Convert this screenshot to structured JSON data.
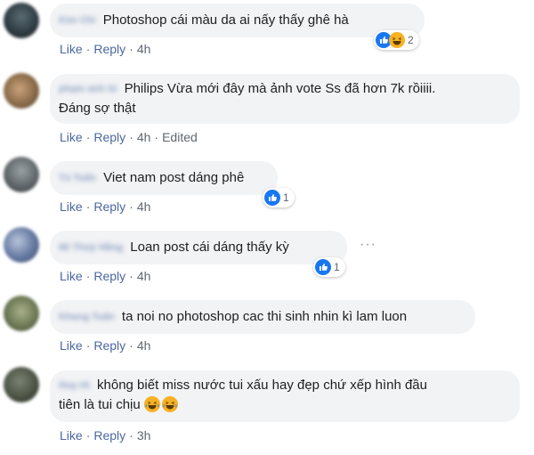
{
  "comments": [
    {
      "author": "Kim Chi",
      "text": "Photoshop cái màu da ai nấy thấy ghê hà",
      "actions": {
        "like": "Like",
        "reply": "Reply",
        "time": "4h"
      },
      "reactions": {
        "icons": [
          "like-icon",
          "haha-icon"
        ],
        "count": "2"
      }
    },
    {
      "author": "phạm anh tú",
      "text_line1": "Philips Vừa mới đây mà ảnh vote Ss đã hơn 7k rồiiii.",
      "text_line2": "Đáng sợ thật",
      "actions": {
        "like": "Like",
        "reply": "Reply",
        "time": "4h",
        "edited": "Edited"
      }
    },
    {
      "author": "Tú Tuấn",
      "text": "Viet nam post dáng phê",
      "actions": {
        "like": "Like",
        "reply": "Reply",
        "time": "4h"
      },
      "reactions": {
        "icons": [
          "like-icon"
        ],
        "count": "1"
      }
    },
    {
      "author": "Mi Thuỳ Hằng",
      "text": "Loan post cái dáng thấy kỳ",
      "actions": {
        "like": "Like",
        "reply": "Reply",
        "time": "4h"
      },
      "reactions": {
        "icons": [
          "like-icon"
        ],
        "count": "1"
      },
      "more": "···"
    },
    {
      "author": "Khang Tuấn",
      "text": "ta noi no photoshop cac thi sinh nhin kì lam luon",
      "actions": {
        "like": "Like",
        "reply": "Reply",
        "time": "4h"
      }
    },
    {
      "author": "Huy Hi",
      "text_line1": "không biết miss nước tui xấu hay đẹp chứ xếp hình đầu",
      "text_line2": "tiên là tui chịu",
      "emoji": [
        "haha-icon",
        "haha-icon"
      ],
      "actions": {
        "like": "Like",
        "reply": "Reply",
        "time": "3h"
      }
    }
  ],
  "colors": {
    "action_link": "#4b67a1",
    "bubble_bg": "#f2f3f5",
    "like_blue": "#1877f2",
    "haha_yellow": "#f7b125"
  },
  "sep": "·"
}
